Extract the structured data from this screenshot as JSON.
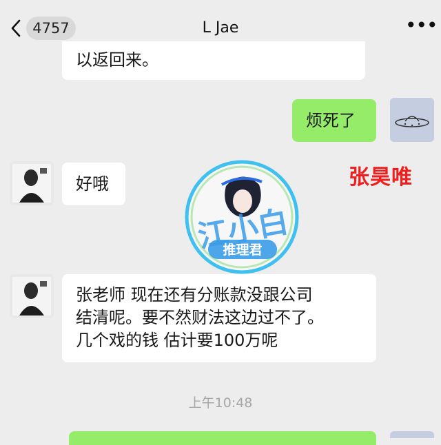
{
  "header": {
    "unread_count": "4757",
    "title": "L Jae",
    "more_icon": "•••"
  },
  "messages": [
    {
      "side": "in",
      "text": "以返回来。"
    },
    {
      "side": "out",
      "text": "烦死了"
    },
    {
      "side": "in",
      "text": "好哦"
    },
    {
      "side": "in",
      "lines": [
        "张老师 现在还有分账款没跟公司",
        "结清呢。要不然财法这边过不了。",
        "几个戏的钱 估计要100万呢"
      ]
    }
  ],
  "timestamp": "上午10:48",
  "watermark": {
    "name": "张昊唯",
    "logo_text": "江小白",
    "logo_subtext": "推理君"
  },
  "colors": {
    "background": "#ededed",
    "outgoing_bubble": "#95ec69",
    "incoming_bubble": "#ffffff",
    "watermark_red": "#f01d1d"
  }
}
